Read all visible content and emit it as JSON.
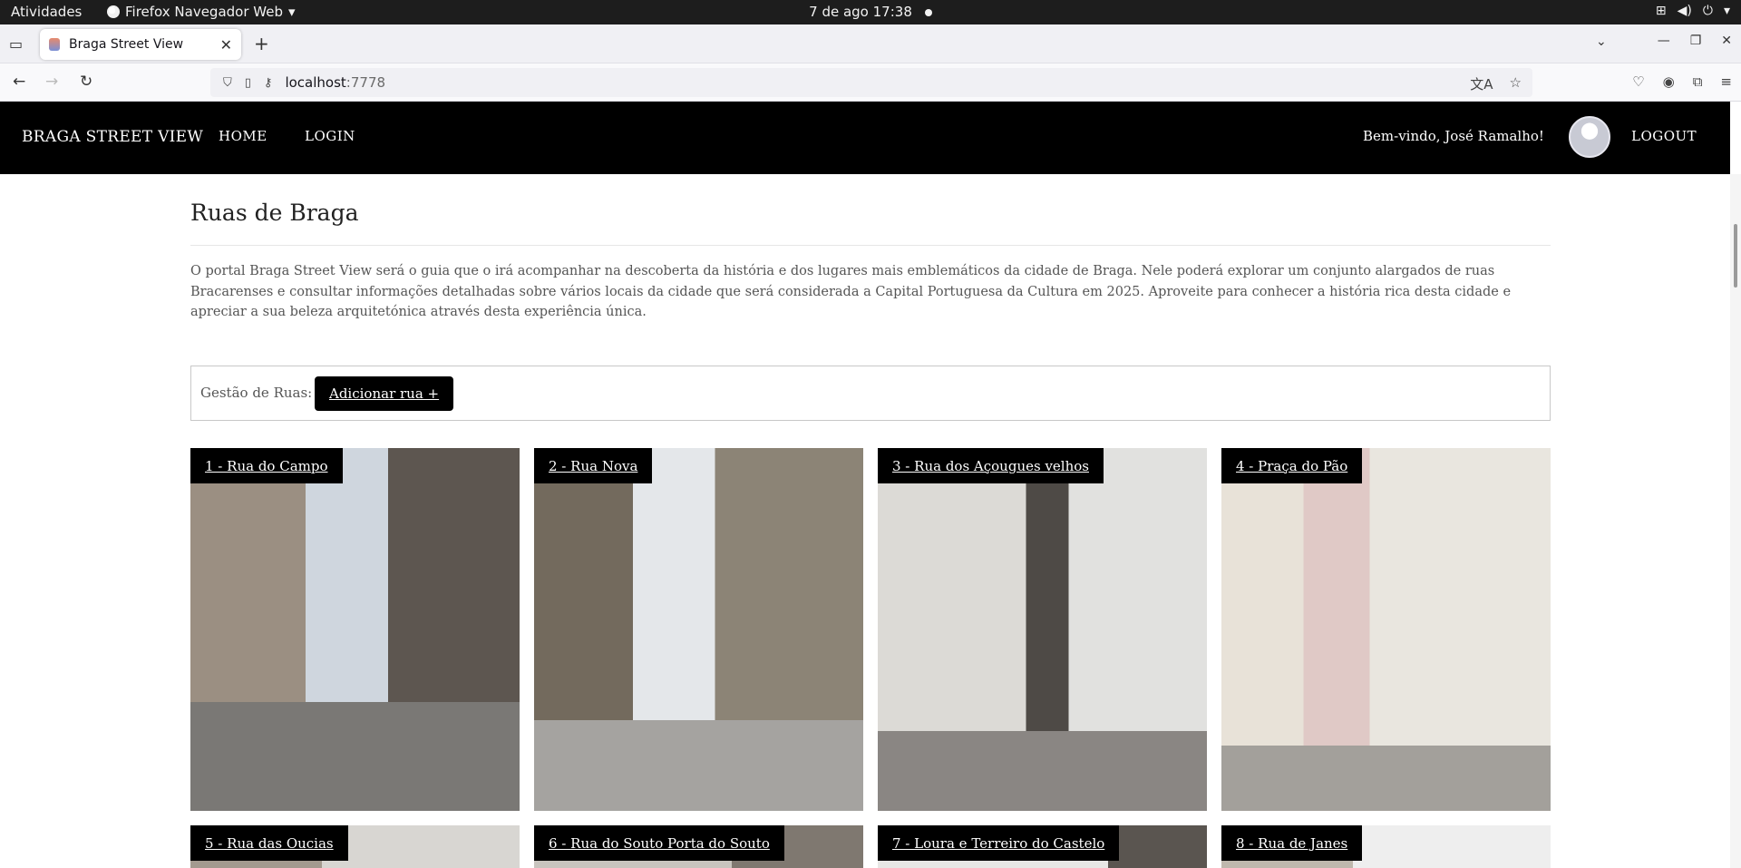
{
  "system_bar": {
    "activities": "Atividades",
    "app_menu": "Firefox Navegador Web",
    "clock": "7 de ago  17:38"
  },
  "browser": {
    "tab_title": "Braga Street View",
    "url_host": "localhost",
    "url_port": ":7778"
  },
  "site": {
    "brand": "BRAGA STREET VIEW",
    "nav": [
      "HOME",
      "LOGIN"
    ],
    "welcome": "Bem-vindo, José Ramalho!",
    "logout": "LOGOUT"
  },
  "page": {
    "title": "Ruas de Braga",
    "intro": "O portal Braga Street View será o guia que o irá acompanhar na descoberta da história e dos lugares mais emblemáticos da cidade de Braga. Nele poderá explorar um conjunto alargados de ruas Bracarenses e consultar informações detalhadas sobre vários locais da cidade que será considerada a Capital Portuguesa da Cultura em 2025. Aproveite para conhecer a história rica desta cidade e apreciar a sua beleza arquitetónica através desta experiência única.",
    "management_label": "Gestão de Ruas:",
    "add_button": "Adicionar rua +"
  },
  "streets": [
    "1 - Rua do Campo",
    "2 - Rua Nova",
    "3 - Rua dos Açougues velhos",
    "4 - Praça do Pão",
    "5 - Rua das Oucias",
    "6 - Rua do Souto Porta do Souto",
    "7 - Loura e Terreiro do Castelo",
    "8 - Rua de Janes"
  ]
}
